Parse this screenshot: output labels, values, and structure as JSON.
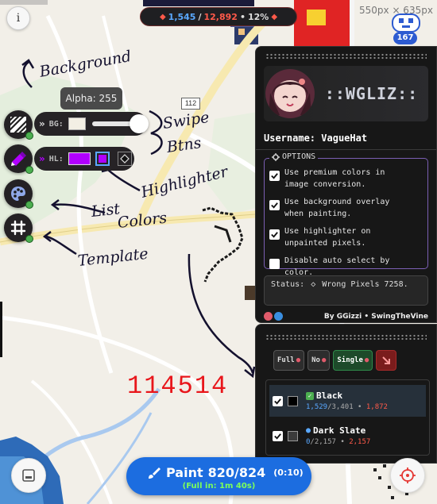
{
  "page": {
    "width": 550,
    "height": 635,
    "dimensions_label": "550px × 635px"
  },
  "info_button": {
    "label": "i"
  },
  "pixel_counter": {
    "painted": "1,545",
    "total": "12,892",
    "percent": "12%",
    "separator": "/",
    "sep2": "•"
  },
  "level_badge": {
    "value": "167"
  },
  "alpha_tooltip": {
    "text": "Alpha: 255",
    "value": 255,
    "max": 255
  },
  "road_label": "112",
  "bg_control": {
    "label": "BG:",
    "swatch_color": "#f3efe4",
    "slider_fraction": 1.0
  },
  "hl_control": {
    "label": "HL:",
    "swatch_color": "#b100ff"
  },
  "annotations": {
    "background": "Background",
    "swipe": "Swipe",
    "btns": "Btns",
    "highlighter": "Highlighter",
    "list": "List",
    "colors": "Colors",
    "template": "Template"
  },
  "red_number": "114514",
  "profile_panel": {
    "brand": "::WGLIZ::",
    "username_label": "Username:",
    "username": "VagueHat",
    "options_title": "OPTIONS",
    "options": [
      {
        "label": "Use premium colors in image conversion.",
        "checked": true
      },
      {
        "label": "Use background overlay when painting.",
        "checked": true
      },
      {
        "label": "Use highlighter on unpainted pixels.",
        "checked": true
      },
      {
        "label": "Disable auto select by color.",
        "checked": false
      }
    ],
    "status_label": "Status:",
    "status_text": "Wrong Pixels 7258.",
    "credits_text": "By GGizzi • SwingTheVine"
  },
  "color_panel": {
    "modes": [
      "Full",
      "No",
      "Single"
    ],
    "active_mode": "Single",
    "colors": [
      {
        "name": "Black",
        "painted": "1,529",
        "total": "3,401",
        "wrong": "1,872",
        "hex": "#000000",
        "checked": true,
        "sep": "/",
        "dot": "•"
      },
      {
        "name": "Dark Slate",
        "painted": "0",
        "total": "2,157",
        "wrong": "2,157",
        "hex": "#3c3c3c",
        "checked": true,
        "sep": "/",
        "dot": "•"
      }
    ]
  },
  "paint_button": {
    "label": "Paint",
    "progress": "820/824",
    "cooldown": "(0:10)",
    "full_in": "(Full in: 1m 40s)"
  },
  "colors": {
    "accent_blue": "#1c6de0",
    "panel_bg": "#171717",
    "error_red": "#ff5a4a",
    "success_green": "#4caf50",
    "highlight_purple": "#b100ff"
  }
}
